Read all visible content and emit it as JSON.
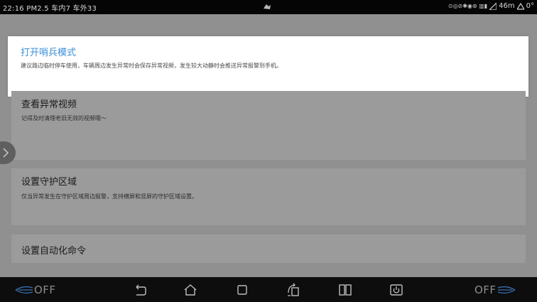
{
  "status_bar": {
    "time": "22:16",
    "air_quality": "PM2.5",
    "inside_temp": "车内7",
    "outside_temp": "车外33",
    "network_speed": "46m",
    "signal_level": "0°"
  },
  "cards": [
    {
      "title": "打开哨兵模式",
      "description": "建议路边临时停车使用，车辆周边发生异常时会保存异常视频，发生较大动静时会推送异常报警到手机。"
    },
    {
      "title": "查看异常视频",
      "description": "记得及时清理老旧无效的视频哦～"
    },
    {
      "title": "设置守护区域",
      "description": "仅当异常发生在守护区域周边报警，支持横屏和竖屏的守护区域设置。"
    },
    {
      "title": "设置自动化命令"
    }
  ],
  "nav_bar": {
    "left_climate": "OFF",
    "right_climate": "OFF",
    "icons": [
      "back-icon",
      "home-icon",
      "recent-apps-icon",
      "rotate-icon",
      "split-screen-icon",
      "power-icon"
    ]
  },
  "colors": {
    "accent": "#3a8fd6",
    "status_bar_bg": "#050505",
    "nav_bar_bg": "#0d0d0d",
    "overlay": "#909090",
    "highlight_card": "#ffffff",
    "climate_icon": "#3a6fb0"
  }
}
